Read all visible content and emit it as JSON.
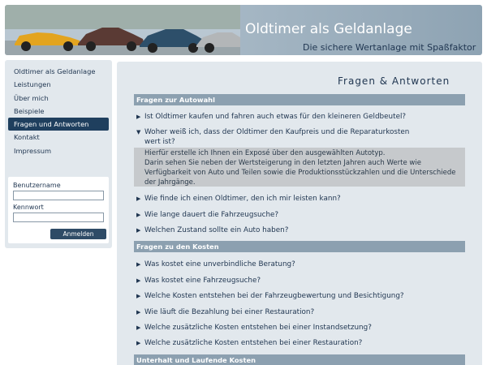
{
  "header": {
    "title": "Oldtimer als Geldanlage",
    "subtitle": "Die sichere Wertanlage mit Spaßfaktor"
  },
  "nav": {
    "items": [
      {
        "label": "Oldtimer als Geldanlage",
        "active": false
      },
      {
        "label": "Leistungen",
        "active": false
      },
      {
        "label": "Über mich",
        "active": false
      },
      {
        "label": "Beispiele",
        "active": false
      },
      {
        "label": "Fragen und Antworten",
        "active": true
      },
      {
        "label": "Kontakt",
        "active": false
      },
      {
        "label": "Impressum",
        "active": false
      }
    ]
  },
  "login": {
    "username_label": "Benutzername",
    "password_label": "Kennwort",
    "button_label": "Anmelden"
  },
  "main": {
    "title": "Fragen & Antworten",
    "sections": [
      {
        "title": "Fragen zur Autowahl",
        "questions": [
          {
            "text": "Ist Oldtimer kaufen und fahren auch etwas für den kleineren Geldbeutel?",
            "expanded": false
          },
          {
            "text": "Woher weiß ich, dass der Oldtimer den Kaufpreis und die Reparaturkosten",
            "text2": "wert ist?",
            "expanded": true,
            "answer": [
              "Hierfür erstelle ich Ihnen ein Exposé über den ausgewählten Autotyp.",
              "Darin sehen Sie neben der Wertsteigerung in den letzten Jahren auch Werte wie",
              "Verfügbarkeit von Auto und Teilen sowie die Produktionsstückzahlen und die Unterschiede",
              "der Jahrgänge."
            ]
          },
          {
            "text": "Wie finde ich einen Oldtimer, den ich mir leisten kann?",
            "expanded": false
          },
          {
            "text": "Wie lange dauert die Fahrzeugsuche?",
            "expanded": false
          },
          {
            "text": "Welchen Zustand sollte ein Auto haben?",
            "expanded": false
          }
        ]
      },
      {
        "title": "Fragen zu den Kosten",
        "questions": [
          {
            "text": "Was kostet eine unverbindliche Beratung?"
          },
          {
            "text": "Was kostet eine Fahrzeugsuche?"
          },
          {
            "text": "Welche Kosten entstehen bei der Fahrzeugbewertung und Besichtigung?"
          },
          {
            "text": "Wie läuft die Bezahlung bei einer Restauration?"
          },
          {
            "text": "Welche zusätzliche Kosten entstehen bei einer Instandsetzung?"
          },
          {
            "text": "Welche zusätzliche Kosten entstehen bei einer Restauration?"
          }
        ]
      },
      {
        "title": "Unterhalt und Laufende Kosten",
        "questions": []
      }
    ]
  },
  "icons": {
    "collapsed": "triangle-right-icon",
    "expanded": "triangle-down-icon"
  },
  "colors": {
    "nav_active": "#1f3f5e",
    "section_head": "#8ca0b0",
    "panel_bg": "#e2e8ed",
    "answer_bg": "#c6c9cc"
  }
}
